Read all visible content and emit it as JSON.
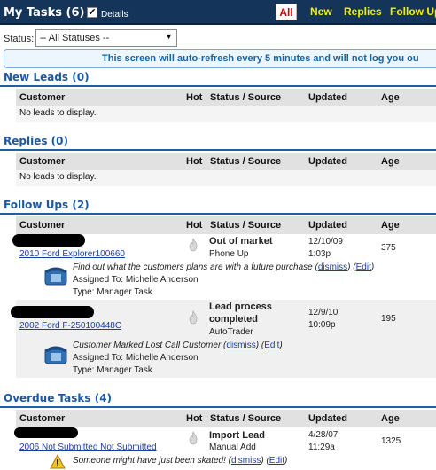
{
  "header": {
    "title": "My Tasks (6)",
    "details_label": "Details",
    "details_checked": true,
    "tabs": [
      {
        "label": "All",
        "active": true
      },
      {
        "label": "New",
        "active": false
      },
      {
        "label": "Replies",
        "active": false
      },
      {
        "label": "Follow Up",
        "active": false
      }
    ]
  },
  "filter": {
    "label": "Status:",
    "selected": "-- All Statuses --"
  },
  "notice": "This screen will auto-refresh every 5 minutes and will not log you ou",
  "columns": {
    "customer": "Customer",
    "hot": "Hot",
    "status_source": "Status / Source",
    "updated": "Updated",
    "age": "Age"
  },
  "sections": {
    "new_leads": {
      "title": "New Leads (0)",
      "empty": "No leads to display."
    },
    "replies": {
      "title": "Replies (0)",
      "empty": "No leads to display."
    },
    "follow_ups": {
      "title": "Follow Ups (2)",
      "rows": [
        {
          "vehicle": "2010 Ford Explorer100660",
          "status": "Out of market",
          "source": "Phone Up",
          "updated_date": "12/10/09",
          "updated_time": "1:03p",
          "age": "375",
          "task_note": "Find out what the customers plans are with a future purchase",
          "dismiss": "dismiss",
          "edit": "Edit",
          "assigned": "Assigned To: Michelle Anderson",
          "type": "Type: Manager Task"
        },
        {
          "vehicle": "2002 Ford F-250100448C",
          "status_line1": "Lead process",
          "status_line2": "completed",
          "source": "AutoTrader",
          "updated_date": "12/9/10",
          "updated_time": "10:09p",
          "age": "195",
          "task_note": "Customer Marked Lost Call Customer",
          "dismiss": "dismiss",
          "edit": "Edit",
          "assigned": "Assigned To: Michelle Anderson",
          "type": "Type: Manager Task"
        }
      ]
    },
    "overdue": {
      "title": "Overdue Tasks (4)",
      "rows": [
        {
          "vehicle": "2006 Not Submitted Not Submitted",
          "status": "Import Lead",
          "source": "Manual Add",
          "updated_date": "4/28/07",
          "updated_time": "11:29a",
          "age": "1325",
          "task_note": "Someone might have just been skated!",
          "dismiss": "dismiss",
          "edit": "Edit"
        }
      ]
    }
  },
  "colors": {
    "topbar": "#15345a",
    "tab_text": "#f3f000",
    "section_title": "#1c58a3",
    "link": "#1a3da0"
  },
  "icons": [
    "checkbox-icon",
    "dropdown-arrow-icon",
    "flame-icon",
    "phone-icon",
    "warning-icon"
  ]
}
